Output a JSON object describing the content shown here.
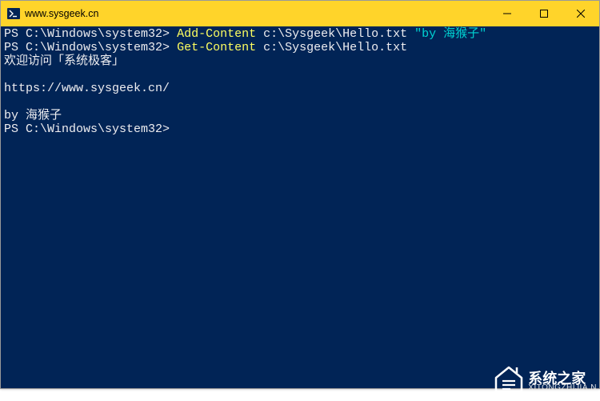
{
  "window": {
    "title": "www.sysgeek.cn"
  },
  "terminal": {
    "lines": [
      {
        "prompt": "PS C:\\Windows\\system32>",
        "cmdlet": "Add-Content",
        "arg": "c:\\Sysgeek\\Hello.txt",
        "string": "\"by 海猴子\""
      },
      {
        "prompt": "PS C:\\Windows\\system32>",
        "cmdlet": "Get-Content",
        "arg": "c:\\Sysgeek\\Hello.txt"
      }
    ],
    "output": [
      "欢迎访问「系统极客」",
      "",
      "https://www.sysgeek.cn/",
      "",
      "by 海猴子"
    ],
    "final_prompt": "PS C:\\Windows\\system32>"
  },
  "watermark": {
    "brand": "系统之家",
    "url": "XITONGZHIJIA.N"
  }
}
